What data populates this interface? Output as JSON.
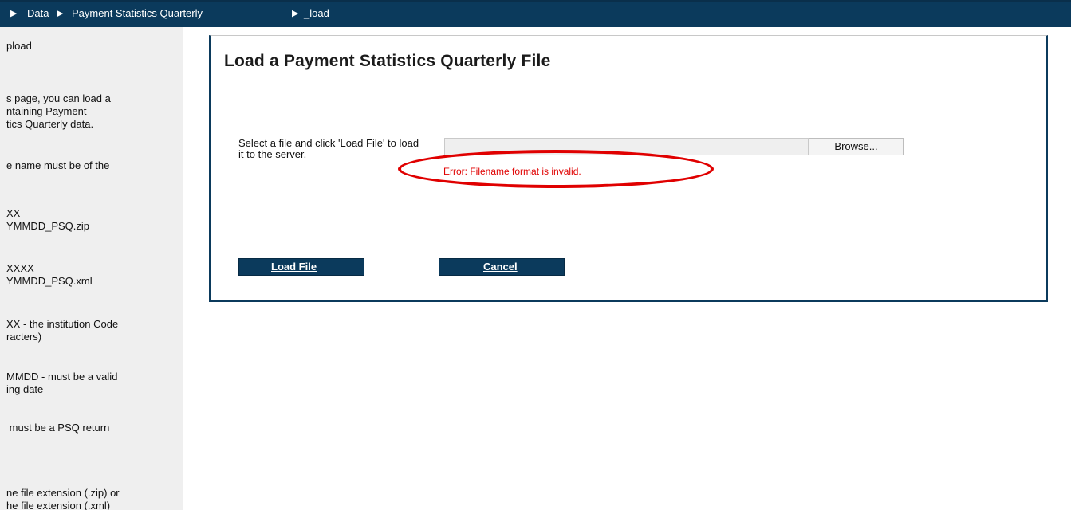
{
  "breadcrumb": {
    "items": [
      "Data",
      "Payment Statistics Quarterly",
      "_load"
    ]
  },
  "sidebar": {
    "title": "pload",
    "paragraphs": [
      "s page, you can load a\nntaining Payment\ntics Quarterly data.",
      "e name must be of the",
      "XX\nYMMDD_PSQ.zip",
      "XXXX\nYMMDD_PSQ.xml",
      "XX - the institution Code\nracters)",
      "MMDD - must be a valid\ning date",
      " must be a PSQ return",
      "ne file extension (.zip) or\nhe file extension (.xml)"
    ]
  },
  "main": {
    "title": "Load a Payment Statistics Quarterly File",
    "instruction": "Select a file and click 'Load File' to load it to the server.",
    "file_input": {
      "value": ""
    },
    "browse_label": "Browse...",
    "error_text": "Error: Filename format is invalid.",
    "load_label": "Load File",
    "cancel_label": "Cancel"
  },
  "colors": {
    "header_bg": "#0b3a5c",
    "error": "#e00000",
    "highlight": "#e00000",
    "sidebar_bg": "#efefef"
  }
}
